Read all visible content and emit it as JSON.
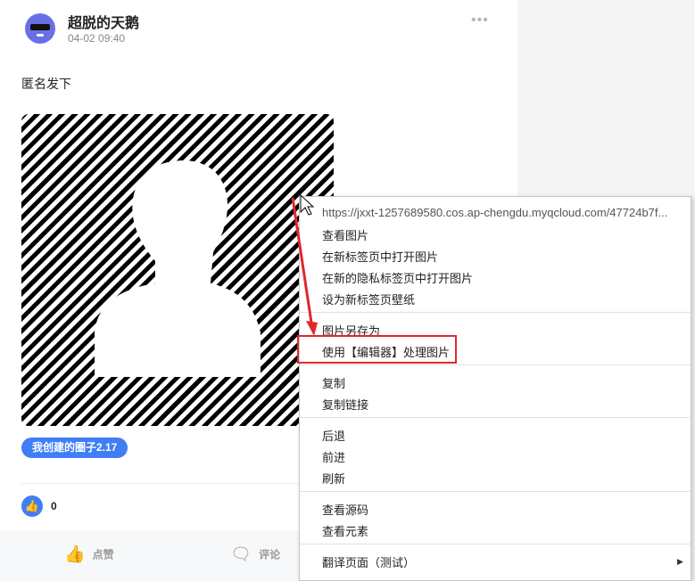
{
  "post": {
    "username": "超脱的天鹅",
    "time": "04-02 09:40",
    "more_icon": "more-dots-icon",
    "content": "匿名发下",
    "topic_tag": "我创建的圈子2.17",
    "like_count": "0",
    "actions": {
      "like_label": "点赞",
      "comment_label": "评论"
    }
  },
  "context_menu": {
    "url": "https://jxxt-1257689580.cos.ap-chengdu.myqcloud.com/47724b7f...",
    "items": [
      "查看图片",
      "在新标签页中打开图片",
      "在新的隐私标签页中打开图片",
      "设为新标签页壁纸",
      "图片另存为",
      "使用【编辑器】处理图片",
      "复制",
      "复制链接",
      "后退",
      "前进",
      "刷新",
      "查看源码",
      "查看元素",
      "翻译页面（测试）"
    ]
  },
  "colors": {
    "accent": "#3f7ef5",
    "annotation_red": "#e0282e",
    "sidebar_bg": "#f4f4f5"
  }
}
